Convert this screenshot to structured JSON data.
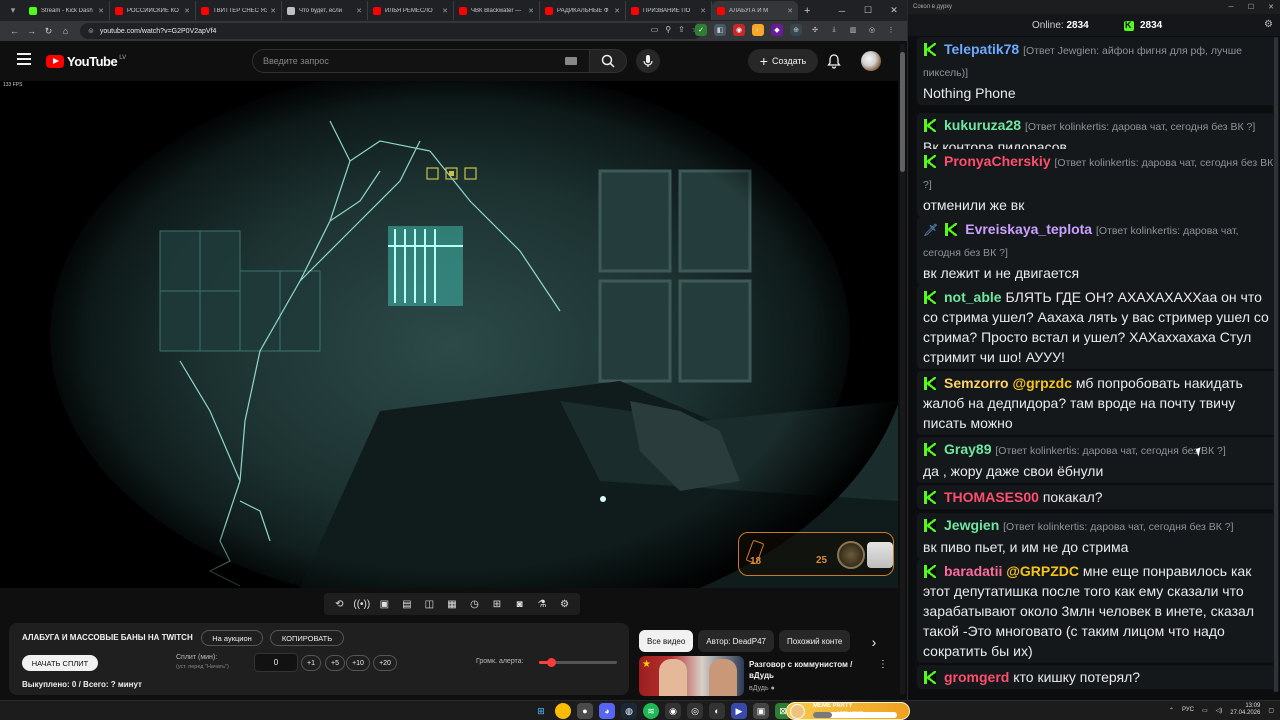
{
  "browser": {
    "tabs": [
      {
        "label": "Stream - Kick Dash",
        "favicon": "kick"
      },
      {
        "label": "РОССИЙСКИЕ КО",
        "favicon": "youtube"
      },
      {
        "label": "ТВИТТЕР СНЕС ЯЗ",
        "favicon": "youtube"
      },
      {
        "label": "Что будет, если",
        "favicon": "x"
      },
      {
        "label": "ИЛЬЯ РЕМЕСЛО",
        "favicon": "youtube"
      },
      {
        "label": "ЧВК Blackwater —",
        "favicon": "youtube"
      },
      {
        "label": "РАДИКАЛЬНЫЕ Ф",
        "favicon": "youtube"
      },
      {
        "label": "ПРИЗВАНИЕ ПО",
        "favicon": "youtube"
      },
      {
        "label": "АЛАБУГА И М",
        "favicon": "youtube",
        "active": true
      }
    ],
    "url": "youtube.com/watch?v=G2P0V2apVf4"
  },
  "youtube": {
    "logo": "YouTube",
    "country": "LV",
    "search_placeholder": "Введите запрос",
    "create_label": "Создать",
    "fps_overlay": "133 FPS",
    "hud": {
      "ammo_mag": "18",
      "ammo_reserve": "25"
    }
  },
  "split_panel": {
    "title": "АЛАБУГА И МАССОВЫЕ БАНЫ НА TWITCH",
    "auction_label": "На аукцион",
    "copy_label": "КОПИРОВАТЬ",
    "start_label": "НАЧАТЬ СПЛИТ",
    "split_label": "Сплит (мин):",
    "split_hint": "(уст. перед \"Начать\")",
    "split_value": "0",
    "steps": [
      "+1",
      "+5",
      "+10",
      "+20"
    ],
    "volume_label": "Громк. алерта:",
    "volume_level": 0.15,
    "stats": "Выкуплено: 0 / Всего: ? минут"
  },
  "recommendations": {
    "chips": [
      {
        "label": "Все видео",
        "active": true
      },
      {
        "label": "Автор: DeadP47"
      },
      {
        "label": "Похожий конте"
      }
    ],
    "video": {
      "title": "Разговор с коммунистом / вДудь",
      "channel": "вДудь"
    }
  },
  "chat": {
    "window_title": "Сокол в дурку",
    "online_label": "Online:",
    "online_count": "2834",
    "kick_count": "2834",
    "messages": [
      {
        "user": "Telepatik78",
        "color": "#6fa8ff",
        "reply": "[Ответ Jewgien: айфон фигня для рф, лучше пиксель)]",
        "text": "Nothing Phone"
      },
      {
        "user": "kukuruza28",
        "color": "#6ee7a0",
        "reply": "[Ответ kolinkertis: дарова чат, сегодня без ВК ?]",
        "text": "Вк контора пидорасов"
      },
      {
        "user": "PronyaCherskiy",
        "color": "#ff4d6d",
        "reply": "[Ответ kolinkertis: дарова чат, сегодня без ВК ?]",
        "text": "отменили же вк"
      },
      {
        "user": "Evreiskaya_teplota",
        "color": "#c9a0ff",
        "reply": "[Ответ kolinkertis: дарова чат, сегодня без ВК ?]",
        "text": "вк лежит и не двигается",
        "badge": "sword"
      },
      {
        "user": "not_able",
        "color": "#6ee7a0",
        "reply": "",
        "text": "БЛЯТЬ ГДЕ ОН? АХАХАХАХХаа он что со стрима ушел? Аахаха лять у вас стример ушел со стрима? Просто встал и ушел? ХАХаххахаха Стул стримит чи шо! АУУУ!"
      },
      {
        "user": "Semzorro",
        "color": "#ffd166",
        "mention": "@grpzdc",
        "reply": "",
        "text": "мб попробовать накидать жалоб на дедпидора? там вроде на почту твичу писать можно"
      },
      {
        "user": "Gray89",
        "color": "#6ee7a0",
        "reply": "[Ответ kolinkertis: дарова чат, сегодня без ВК ?]",
        "text": "да , жору даже свои ёбнули"
      },
      {
        "user": "THOMASES00",
        "color": "#ff4d6d",
        "reply": "",
        "text": "покакал?"
      },
      {
        "user": "Jewgien",
        "color": "#6ee7a0",
        "reply": "[Ответ kolinkertis: дарова чат, сегодня без ВК ?]",
        "text": "вк пиво пьет, и им не до стрима"
      },
      {
        "user": "baradatii",
        "color": "#ff6b9d",
        "mention": "@GRPZDC",
        "reply": "",
        "text": "мне еще понравилось как этот депутатишка после того как ему сказали что зарабатывают около 3млн человек в инете, сказал такой -Это многовато (с таким лицом что надо сократить бы их)"
      },
      {
        "user": "gromgerd",
        "color": "#ff4d6d",
        "reply": "",
        "text": "кто кишку потерял?"
      }
    ]
  },
  "taskbar": {
    "meme_title": "MEME PARTY",
    "meme_value": "1275 / 5500",
    "meme_progress": 0.23,
    "lang": "РУС",
    "time": "13:09",
    "date": "27.04.2026"
  },
  "colors": {
    "kick_green": "#53fc18",
    "yt_red": "#ff0000",
    "hud_orange": "#c87a2a"
  }
}
